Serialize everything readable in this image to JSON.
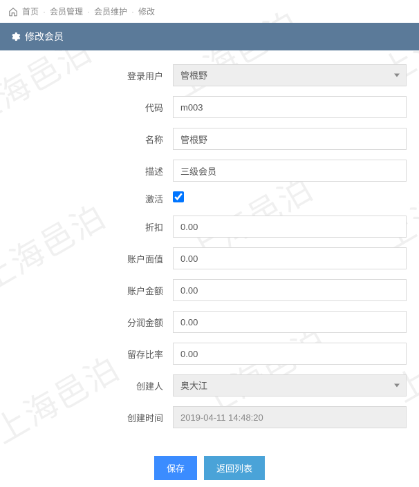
{
  "watermark_text": "上海邑泊",
  "breadcrumb": {
    "home": "首页",
    "items": [
      "会员管理",
      "会员维护",
      "修改"
    ]
  },
  "panel": {
    "title": "修改会员"
  },
  "form": {
    "login_user": {
      "label": "登录用户",
      "value": "管根野"
    },
    "code": {
      "label": "代码",
      "value": "m003"
    },
    "name": {
      "label": "名称",
      "value": "管根野"
    },
    "desc": {
      "label": "描述",
      "value": "三级会员"
    },
    "active": {
      "label": "激活",
      "checked": true
    },
    "discount": {
      "label": "折扣",
      "value": "0.00"
    },
    "face_value": {
      "label": "账户面值",
      "value": "0.00"
    },
    "balance": {
      "label": "账户金额",
      "value": "0.00"
    },
    "commission": {
      "label": "分润金额",
      "value": "0.00"
    },
    "retain": {
      "label": "留存比率",
      "value": "0.00"
    },
    "creator": {
      "label": "创建人",
      "value": "奥大江"
    },
    "created_at": {
      "label": "创建时间",
      "value": "2019-04-11 14:48:20"
    }
  },
  "buttons": {
    "save": "保存",
    "back": "返回列表"
  }
}
